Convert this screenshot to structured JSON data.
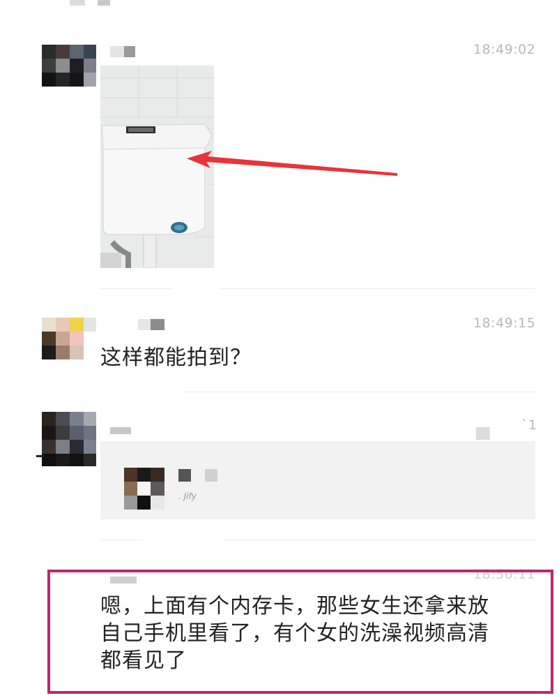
{
  "messages": [
    {
      "time": "18:49:02",
      "type": "image",
      "image_desc": "toilet-tank-photo-with-arrow"
    },
    {
      "time": "18:49:15",
      "type": "text",
      "text": "这样都能拍到？"
    },
    {
      "time": "`1",
      "type": "shared-card",
      "card_caption": ". Jify"
    },
    {
      "time": "18:50:11",
      "type": "text",
      "lines": [
        "嗯，上面有个内存卡，那些女生还拿来放",
        "自己手机里看了，有个女的洗澡视频高清",
        "都看见了"
      ]
    }
  ],
  "colors": {
    "highlight_border": "#c0256e",
    "arrow": "#e8333a",
    "timestamp": "#b8b8b8",
    "card_bg": "#f2f2f2"
  }
}
